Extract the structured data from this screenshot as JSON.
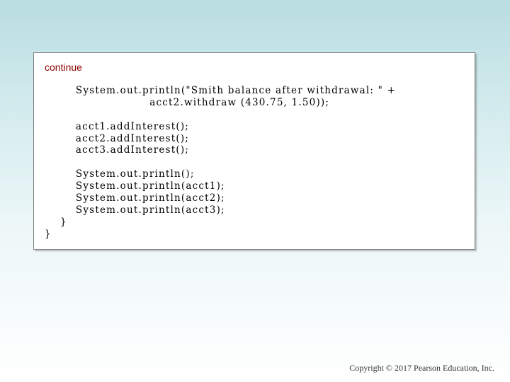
{
  "heading": "continue",
  "code_lines": [
    "        System.out.println(\"Smith balance after withdrawal: \" +",
    "                           acct2.withdraw (430.75, 1.50));",
    "",
    "        acct1.addInterest();",
    "        acct2.addInterest();",
    "        acct3.addInterest();",
    "",
    "        System.out.println();",
    "        System.out.println(acct1);",
    "        System.out.println(acct2);",
    "        System.out.println(acct3);",
    "    }",
    "}"
  ],
  "footer": {
    "copyright": "Copyright © 2017 Pearson Education, Inc."
  },
  "colors": {
    "heading": "#8b0000",
    "panel_border": "#7f7f7f"
  }
}
